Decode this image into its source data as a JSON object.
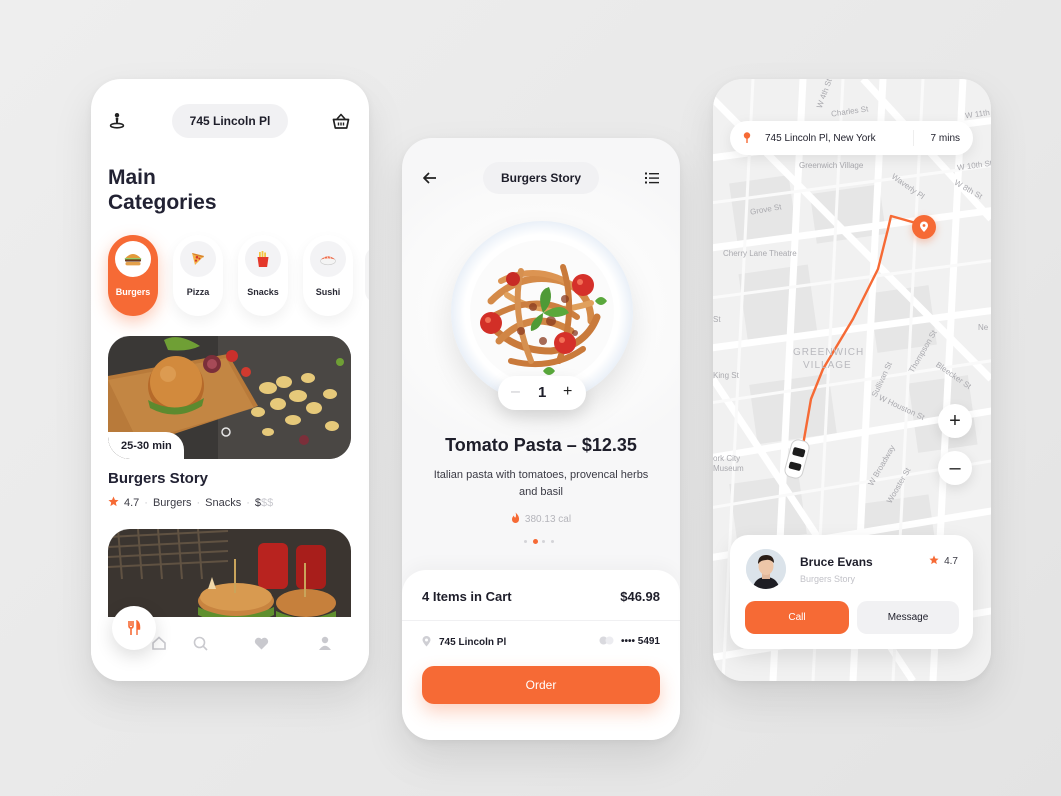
{
  "colors": {
    "accent": "#f66a35",
    "text": "#1e1e2a",
    "muted": "#b5b5bb"
  },
  "home": {
    "location": "745 Lincoln Pl",
    "title_line1": "Main",
    "title_line2": "Categories",
    "categories": [
      {
        "label": "Burgers",
        "icon": "burger-icon",
        "active": true
      },
      {
        "label": "Pizza",
        "icon": "pizza-icon",
        "active": false
      },
      {
        "label": "Snacks",
        "icon": "fries-icon",
        "active": false
      },
      {
        "label": "Sushi",
        "icon": "sushi-icon",
        "active": false
      }
    ],
    "card": {
      "time": "25-30 min",
      "name": "Burgers Story",
      "rating": "4.7",
      "tag1": "Burgers",
      "tag2": "Snacks",
      "price_active": "$",
      "price_dim": "$$"
    },
    "tabs": [
      "home-icon",
      "search-icon",
      "heart-icon",
      "profile-icon"
    ]
  },
  "product": {
    "restaurant": "Burgers Story",
    "quantity": "1",
    "title": "Tomato Pasta – $12.35",
    "description": "Italian pasta with tomatoes, provencal herbs and basil",
    "calories": "380.13 cal",
    "page_dots": {
      "count": 4,
      "active_index": 1
    },
    "cart_label": "4 Items in Cart",
    "cart_total": "$46.98",
    "address": "745 Lincoln Pl",
    "card_masked": "•••• 5491",
    "order_label": "Order"
  },
  "tracking": {
    "address": "745 Lincoln Pl, New York",
    "eta": "7 mins",
    "streets": [
      "W 4th St",
      "Charles St",
      "W 11th St",
      "W 10th St",
      "Greenwich Village",
      "Waverly Pl",
      "W 8th St",
      "Grove St",
      "Cherry Lane Theatre",
      "St",
      "Ne",
      "GREENWICH",
      "VILLAGE",
      "Thompson St",
      "Bleecker St",
      "Sullivan St",
      "King St",
      "W Houston St",
      "W Broadway",
      "Wooster St",
      "ork City",
      "Museum"
    ],
    "driver": {
      "name": "Bruce Evans",
      "subtitle": "Burgers Story",
      "rating": "4.7",
      "call_label": "Call",
      "message_label": "Message"
    }
  }
}
